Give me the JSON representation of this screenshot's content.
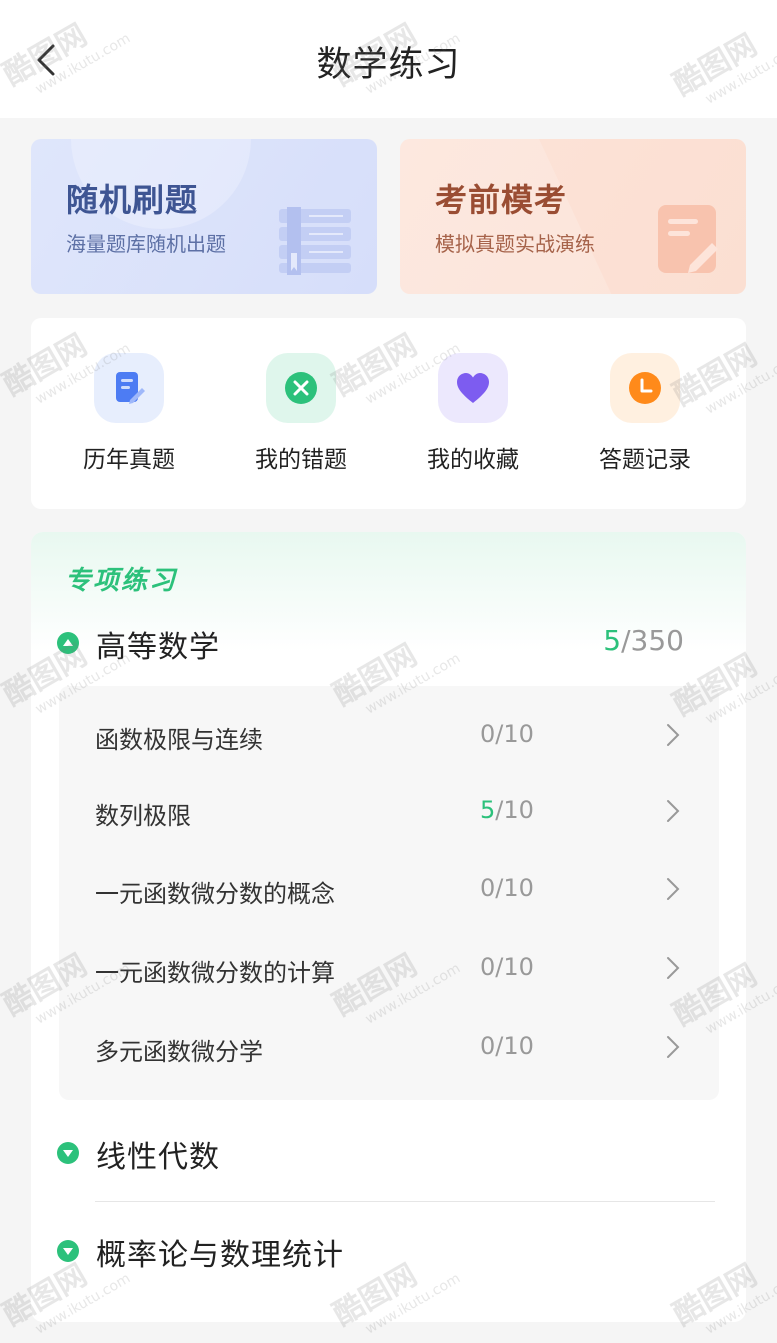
{
  "header": {
    "title": "数学练习"
  },
  "top_cards": [
    {
      "title": "随机刷题",
      "subtitle": "海量题库随机出题"
    },
    {
      "title": "考前模考",
      "subtitle": "模拟真题实战演练"
    }
  ],
  "quick_nav": [
    {
      "label": "历年真题",
      "icon": "document-edit-icon",
      "color": "#4d7cf3"
    },
    {
      "label": "我的错题",
      "icon": "close-circle-icon",
      "color": "#2cc17b"
    },
    {
      "label": "我的收藏",
      "icon": "heart-icon",
      "color": "#7d5cf0"
    },
    {
      "label": "答题记录",
      "icon": "clock-icon",
      "color": "#ff8a1a"
    }
  ],
  "practice": {
    "section_title": "专项练习",
    "groups": [
      {
        "name": "高等数学",
        "done": "5",
        "total": "/350",
        "expanded": true,
        "items": [
          {
            "name": "函数极限与连续",
            "done": "0",
            "total": "/10"
          },
          {
            "name": "数列极限",
            "done": "5",
            "total": "/10"
          },
          {
            "name": "一元函数微分数的概念",
            "done": "0",
            "total": "/10"
          },
          {
            "name": "一元函数微分数的计算",
            "done": "0",
            "total": "/10"
          },
          {
            "name": "多元函数微分学",
            "done": "0",
            "total": "/10"
          }
        ]
      },
      {
        "name": "线性代数",
        "expanded": false
      },
      {
        "name": "概率论与数理统计",
        "expanded": false
      }
    ]
  },
  "colors": {
    "accent": "#2cc17b",
    "random_card": "#d9e1fa",
    "mock_card": "#fde0d4"
  },
  "watermark": {
    "brand": "酷图网",
    "url": "www.ikutu.com"
  }
}
